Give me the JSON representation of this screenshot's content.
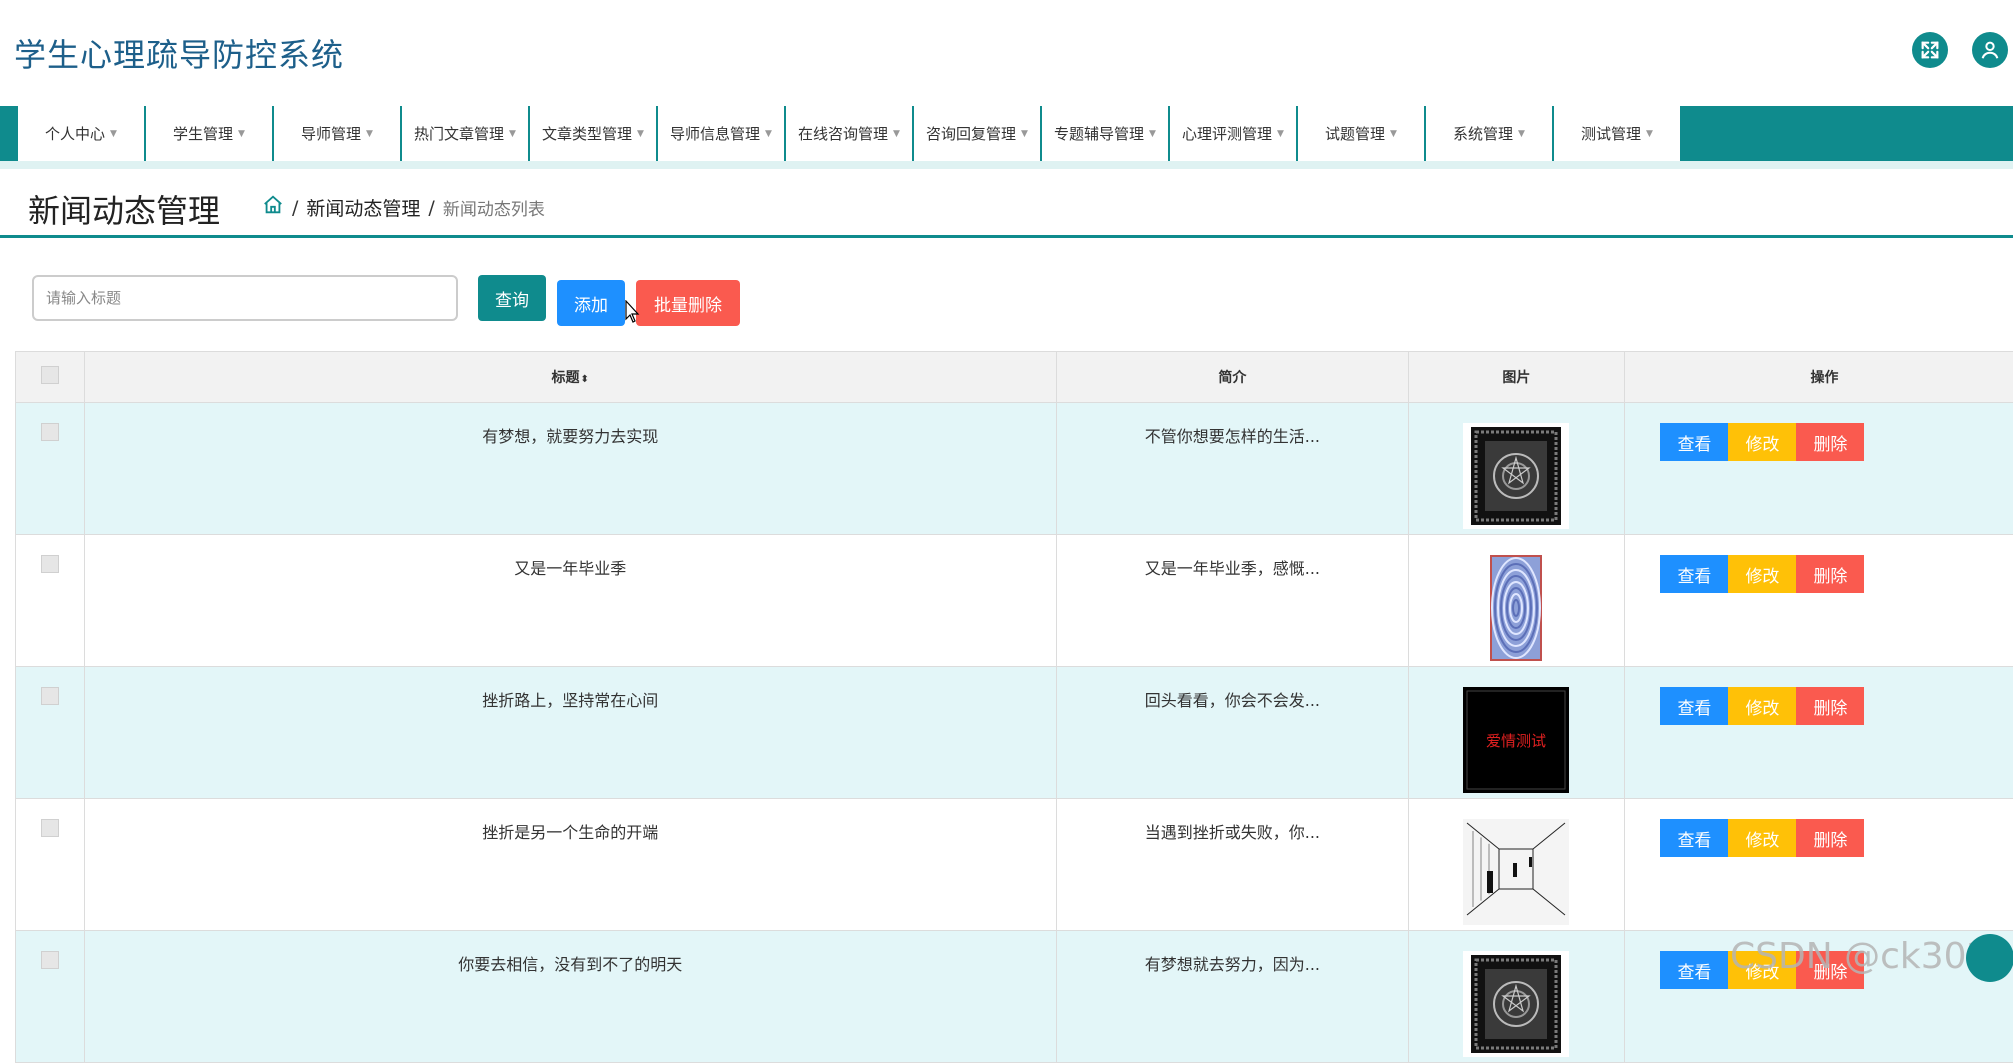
{
  "app": {
    "title": "学生心理疏导防控系统"
  },
  "header_icons": [
    "fullscreen-icon",
    "user-icon"
  ],
  "nav": {
    "items": [
      "个人中心",
      "学生管理",
      "导师管理",
      "热门文章管理",
      "文章类型管理",
      "导师信息管理",
      "在线咨询管理",
      "咨询回复管理",
      "专题辅导管理",
      "心理评测管理",
      "试题管理",
      "系统管理",
      "测试管理"
    ]
  },
  "page": {
    "title": "新闻动态管理",
    "breadcrumb": {
      "sep1": "/",
      "crumb1": "新闻动态管理",
      "sep2": "/",
      "crumb2": "新闻动态列表"
    }
  },
  "search": {
    "placeholder": "请输入标题",
    "query_label": "查询",
    "add_label": "添加",
    "batch_delete_label": "批量删除"
  },
  "table": {
    "headers": {
      "title": "标题",
      "intro": "简介",
      "image": "图片",
      "action": "操作"
    },
    "rows": [
      {
        "title": "有梦想，就要努力去实现",
        "intro": "不管你想要怎样的生活...",
        "image": "pattern-dark-frame"
      },
      {
        "title": "又是一年毕业季",
        "intro": "又是一年毕业季，感慨...",
        "image": "pattern-blue-illusion"
      },
      {
        "title": "挫折路上，坚持常在心间",
        "intro": "回头看看，你会不会发...",
        "image": "red-text-black"
      },
      {
        "title": "挫折是另一个生命的开端",
        "intro": "当遇到挫折或失败，你...",
        "image": "corridor-illusion"
      },
      {
        "title": "你要去相信，没有到不了的明天",
        "intro": "有梦想就去努力，因为...",
        "image": "pattern-dark-frame"
      }
    ],
    "actions": {
      "view": "查看",
      "edit": "修改",
      "delete": "删除"
    },
    "thumb_text": {
      "red": "爱情测试"
    }
  },
  "watermark": "CSDN @ck3025",
  "colors": {
    "primary": "#0f8b8d",
    "blue": "#1e90ff",
    "yellow": "#ffc107",
    "red": "#fa5a4f",
    "row_alt": "#e3f6f8"
  }
}
